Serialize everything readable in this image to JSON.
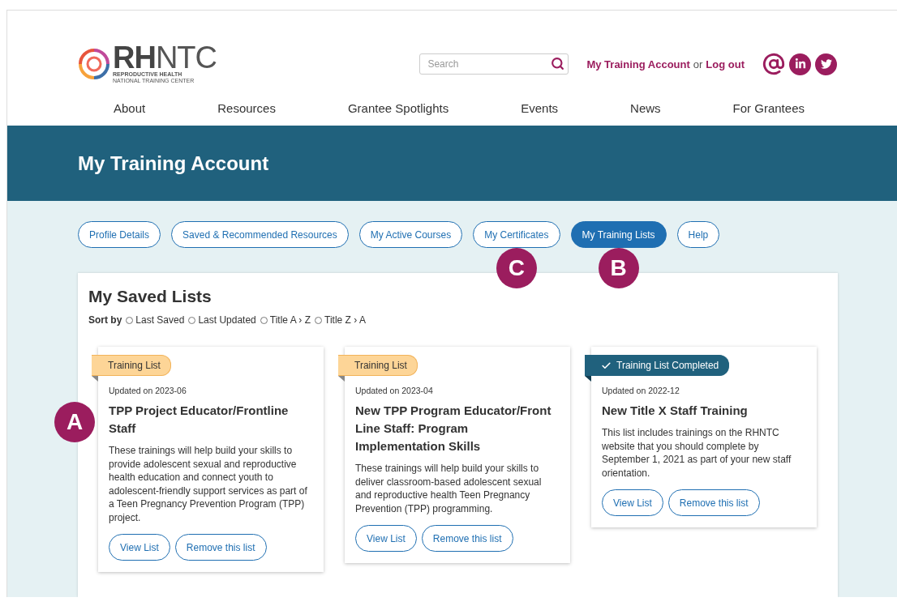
{
  "header": {
    "logo": {
      "mark_bold": "RH",
      "mark_light": "NTC",
      "line_1": "REPRODUCTIVE HEALTH",
      "line_2": "NATIONAL TRAINING CENTER"
    },
    "search": {
      "placeholder": "Search"
    },
    "account_link": "My Training Account",
    "account_or": "or",
    "logout_link": "Log out"
  },
  "nav": [
    "About",
    "Resources",
    "Grantee Spotlights",
    "Events",
    "News",
    "For Grantees"
  ],
  "banner": {
    "title": "My Training Account"
  },
  "tabs": [
    {
      "label": "Profile Details",
      "selected": false
    },
    {
      "label": "Saved & Recommended Resources",
      "selected": false
    },
    {
      "label": "My Active Courses",
      "selected": false
    },
    {
      "label": "My Certificates",
      "selected": false,
      "callout": "C"
    },
    {
      "label": "My Training Lists",
      "selected": true,
      "callout": "B"
    },
    {
      "label": "Help",
      "selected": false
    }
  ],
  "panel": {
    "title": "My Saved Lists",
    "sort_label": "Sort by",
    "sort_options": [
      {
        "label": "Last Saved",
        "selected": false
      },
      {
        "label": "Last Updated",
        "selected": false
      },
      {
        "label": "Title A › Z",
        "selected": false
      },
      {
        "label": "Title Z › A",
        "selected": false
      }
    ]
  },
  "cards": [
    {
      "callout": "A",
      "tag": {
        "kind": "in_progress",
        "label": "Training List"
      },
      "updated": "Updated on 2023-06",
      "title": "TPP Project Educator/Frontline Staff",
      "description": "These trainings will help build your skills to provide adolescent sexual and reproductive health education and connect youth to adolescent-friendly support services as part of a Teen Pregnancy Prevention Program (TPP) project.",
      "buttons": [
        "View List",
        "Remove this list"
      ]
    },
    {
      "tag": {
        "kind": "in_progress",
        "label": "Training List"
      },
      "updated": "Updated on 2023-04",
      "title": "New TPP Program Educator/Front Line Staff: Program Implementation Skills",
      "description": "These trainings will help build your skills to deliver classroom-based adolescent sexual and reproductive health Teen Pregnancy Prevention (TPP) programming.",
      "buttons": [
        "View List",
        "Remove this list"
      ]
    },
    {
      "tag": {
        "kind": "completed",
        "label": "Training List Completed"
      },
      "updated": "Updated on 2022-12",
      "title": "New Title X Staff Training",
      "description": "This list includes trainings on the RHNTC website that you should complete by September 1, 2021 as part of your new staff orientation.",
      "buttons": [
        "View List",
        "Remove this list"
      ]
    }
  ]
}
